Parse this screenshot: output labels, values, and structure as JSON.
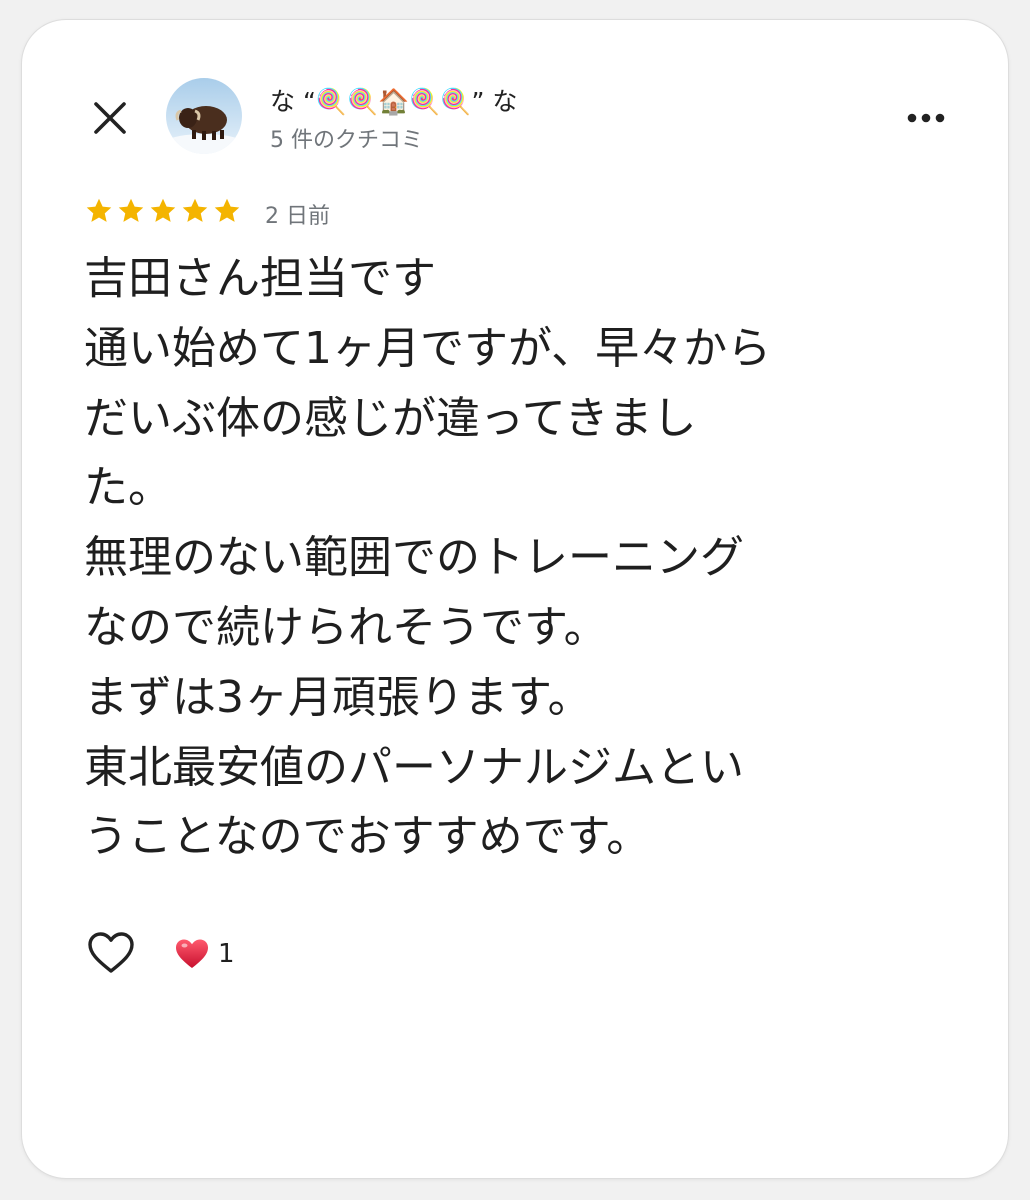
{
  "reviewer": {
    "name": "な “🍭🍭🏠🍭🍭” な",
    "review_count": "5 件のクチコミ"
  },
  "rating": {
    "stars": 5,
    "max": 5,
    "color": "#f4b400"
  },
  "review": {
    "date": "2 日前",
    "text": "吉田さん担当です\n通い始めて1ヶ月ですが、早々から\nだいぶ体の感じが違ってきまし\nた。\n無理のない範囲でのトレーニング\nなので続けられそうです。\nまずは3ヶ月頑張ります。\n東北最安値のパーソナルジムとい\nうことなのでおすすめです。"
  },
  "reactions": {
    "like_icon": "heart-outline-icon",
    "reaction_icon": "red-heart-icon",
    "reaction_count": "1",
    "reaction_color": "#e0245e"
  },
  "icons": {
    "close": "close-icon",
    "more": "more-options-icon",
    "star": "star-icon"
  }
}
